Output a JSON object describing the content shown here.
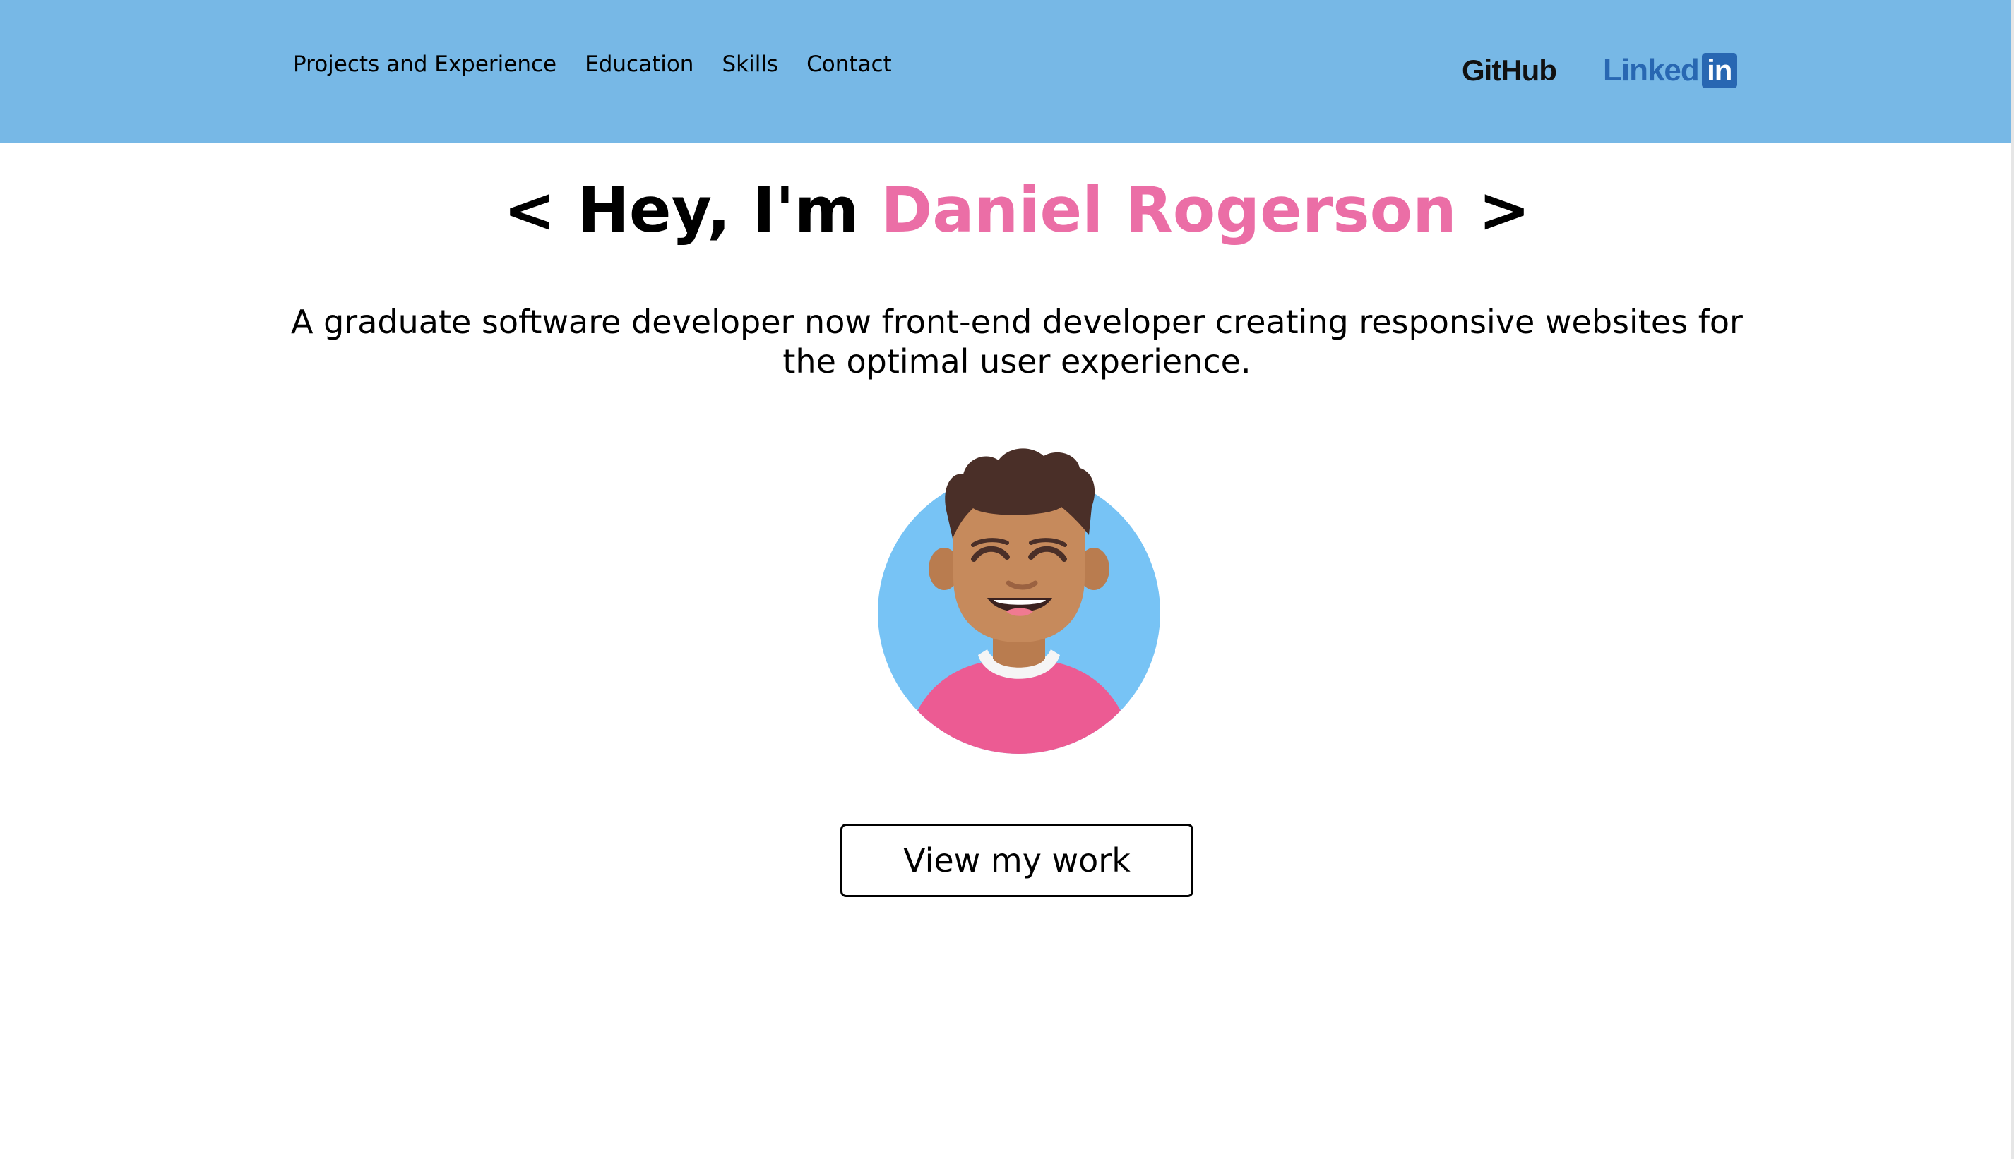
{
  "header": {
    "nav": [
      {
        "label": "Projects and Experience"
      },
      {
        "label": "Education"
      },
      {
        "label": "Skills"
      },
      {
        "label": "Contact"
      }
    ],
    "social": {
      "github_label": "GitHub",
      "linkedin_text": "Linked",
      "linkedin_badge": "in"
    }
  },
  "hero": {
    "title_prefix": "< Hey, I'm",
    "name": "Daniel Rogerson",
    "title_suffix": ">",
    "subtitle": "A graduate software developer now front-end developer creating responsive websites for the optimal user experience.",
    "avatar_icon": "smiling-avatar-icon",
    "cta_label": "View my work"
  },
  "colors": {
    "header_bg": "#77b8e6",
    "name_accent": "#eb6ea6",
    "linkedin_blue": "#2867b2",
    "avatar_bg": "#77c3f5",
    "shirt_pink": "#ec5b93",
    "skin": "#c68a5c",
    "hair": "#4a2f28"
  }
}
